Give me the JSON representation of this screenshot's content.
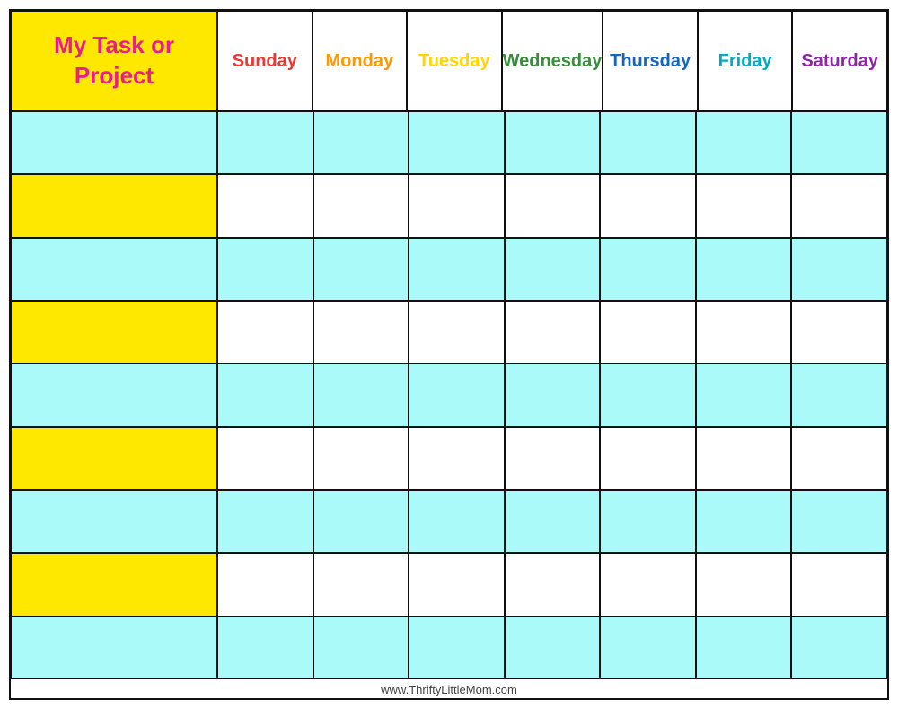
{
  "header": {
    "task_label_line1": "My Task or",
    "task_label_line2": "Project"
  },
  "days": [
    {
      "label": "Sunday",
      "color": "#E53935"
    },
    {
      "label": "Monday",
      "color": "#FF9800"
    },
    {
      "label": "Tuesday",
      "color": "#FFD600"
    },
    {
      "label": "Wednesday",
      "color": "#388E3C"
    },
    {
      "label": "Thursday",
      "color": "#1565C0"
    },
    {
      "label": "Friday",
      "color": "#00ACC1"
    },
    {
      "label": "Saturday",
      "color": "#8E24AA"
    }
  ],
  "rows": [
    {
      "task_bg": "cyan",
      "day_bgs": [
        "cyan",
        "cyan",
        "cyan",
        "cyan",
        "cyan",
        "cyan",
        "cyan"
      ]
    },
    {
      "task_bg": "yellow",
      "day_bgs": [
        "white",
        "white",
        "white",
        "white",
        "white",
        "white",
        "white"
      ]
    },
    {
      "task_bg": "cyan",
      "day_bgs": [
        "cyan",
        "cyan",
        "cyan",
        "cyan",
        "cyan",
        "cyan",
        "cyan"
      ]
    },
    {
      "task_bg": "yellow",
      "day_bgs": [
        "white",
        "white",
        "white",
        "white",
        "white",
        "white",
        "white"
      ]
    },
    {
      "task_bg": "cyan",
      "day_bgs": [
        "cyan",
        "cyan",
        "cyan",
        "cyan",
        "cyan",
        "cyan",
        "cyan"
      ]
    },
    {
      "task_bg": "yellow",
      "day_bgs": [
        "white",
        "white",
        "white",
        "white",
        "white",
        "white",
        "white"
      ]
    },
    {
      "task_bg": "cyan",
      "day_bgs": [
        "cyan",
        "cyan",
        "cyan",
        "cyan",
        "cyan",
        "cyan",
        "cyan"
      ]
    },
    {
      "task_bg": "yellow",
      "day_bgs": [
        "white",
        "white",
        "white",
        "white",
        "white",
        "white",
        "white"
      ]
    },
    {
      "task_bg": "cyan",
      "day_bgs": [
        "cyan",
        "cyan",
        "cyan",
        "cyan",
        "cyan",
        "cyan",
        "cyan"
      ]
    }
  ],
  "footer": {
    "url": "www.ThriftyLittleMom.com"
  }
}
